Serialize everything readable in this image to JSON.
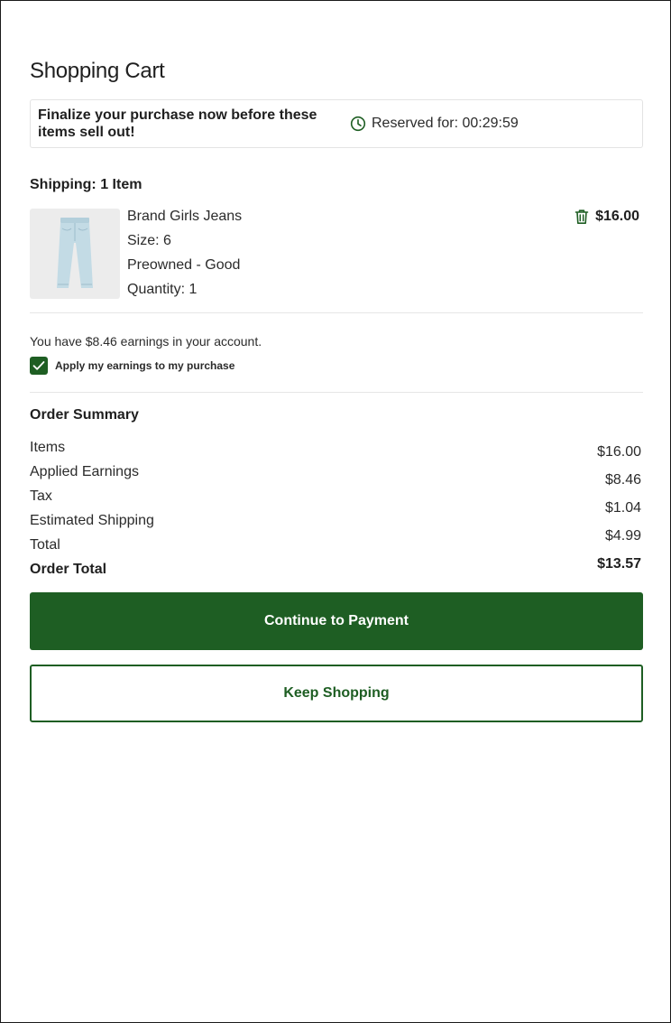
{
  "page": {
    "title": "Shopping Cart"
  },
  "banner": {
    "message": "Finalize your purchase now before these items sell out!",
    "reserved_label": "Reserved for: 00:29:59",
    "icon": "clock-icon"
  },
  "shipping": {
    "heading": "Shipping: 1 Item",
    "item": {
      "name": "Brand Girls Jeans",
      "size": "Size: 6",
      "condition": "Preowned - Good",
      "quantity": "Quantity: 1",
      "price": "$16.00",
      "image_icon": "jeans-icon",
      "delete_icon": "trash-icon"
    }
  },
  "earnings": {
    "text": "You have $8.46 earnings in your account.",
    "apply_label": "Apply my earnings to my purchase",
    "apply_checked": true
  },
  "summary": {
    "heading": "Order Summary",
    "labels": [
      "Items",
      "Applied Earnings",
      "Tax",
      "Estimated Shipping",
      "Total",
      "Order Total"
    ],
    "values": [
      "$16.00",
      "$8.46",
      "$1.04",
      "$4.99",
      "$13.57"
    ]
  },
  "actions": {
    "continue_label": "Continue to Payment",
    "keep_label": "Keep Shopping"
  },
  "colors": {
    "brand_green": "#1e5e23",
    "divider": "#e6e6e6"
  }
}
